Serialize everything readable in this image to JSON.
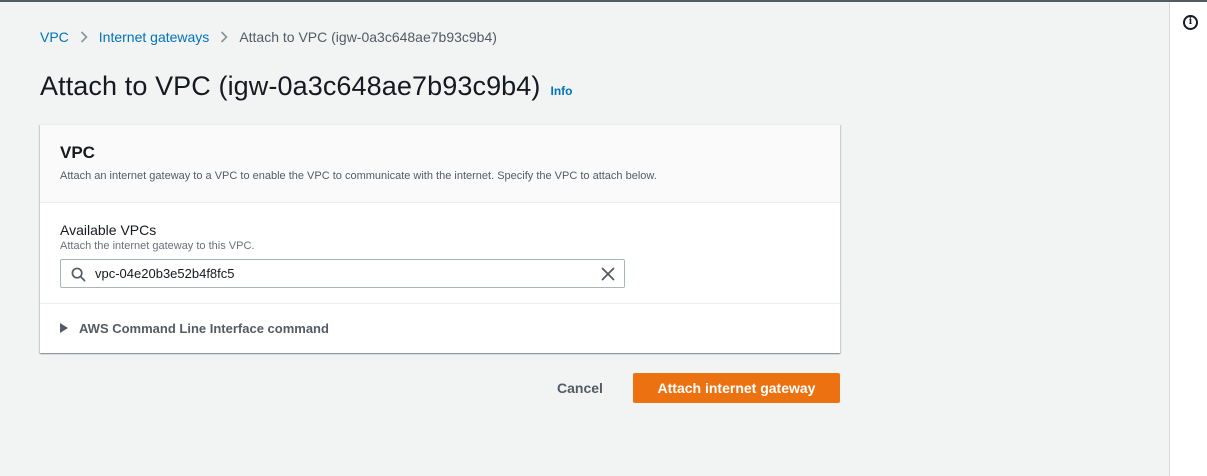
{
  "breadcrumb": {
    "items": [
      "VPC",
      "Internet gateways"
    ],
    "current": "Attach to VPC (igw-0a3c648ae7b93c9b4)"
  },
  "page": {
    "title": "Attach to VPC (igw-0a3c648ae7b93c9b4)",
    "info_label": "Info"
  },
  "panel": {
    "title": "VPC",
    "description": "Attach an internet gateway to a VPC to enable the VPC to communicate with the internet. Specify the VPC to attach below."
  },
  "field": {
    "label": "Available VPCs",
    "description": "Attach the internet gateway to this VPC.",
    "value": "vpc-04e20b3e52b4f8fc5"
  },
  "cli": {
    "label": "AWS Command Line Interface command"
  },
  "actions": {
    "cancel_label": "Cancel",
    "primary_label": "Attach internet gateway"
  },
  "colors": {
    "accent": "#ec7211",
    "link": "#0073bb",
    "background": "#f2f3f3"
  },
  "icons": {
    "right_panel": "info-circle-icon",
    "search": "search-icon",
    "clear": "close-icon",
    "expander": "caret-right-icon"
  }
}
